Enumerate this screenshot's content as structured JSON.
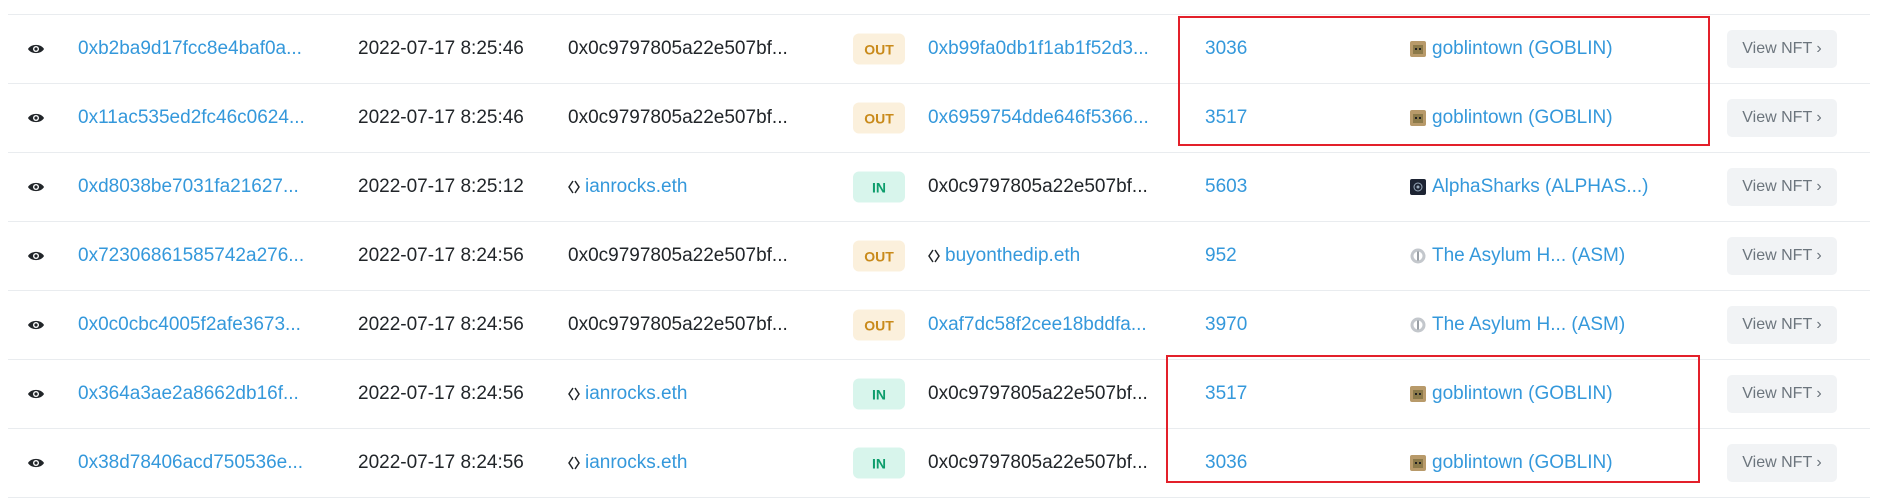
{
  "rows": [
    {
      "hash": "0xb2ba9d17fcc8e4baf0a...",
      "age": "2022-07-17 8:25:46",
      "from": "0x0c9797805a22e507bf...",
      "dir": "OUT",
      "to": "0xb99fa0db1f1ab1f52d3...",
      "token_id": "3036",
      "item": "goblintown (GOBLIN)",
      "button": "View NFT ›"
    },
    {
      "hash": "0x11ac535ed2fc46c0624...",
      "age": "2022-07-17 8:25:46",
      "from": "0x0c9797805a22e507bf...",
      "dir": "OUT",
      "to": "0x6959754dde646f5366...",
      "token_id": "3517",
      "item": "goblintown (GOBLIN)",
      "button": "View NFT ›"
    },
    {
      "hash": "0xd8038be7031fa21627...",
      "age": "2022-07-17 8:25:12",
      "from": "ianrocks.eth",
      "dir": "IN",
      "to": "0x0c9797805a22e507bf...",
      "token_id": "5603",
      "item": "AlphaSharks (ALPHAS...)",
      "button": "View NFT ›"
    },
    {
      "hash": "0x72306861585742a276...",
      "age": "2022-07-17 8:24:56",
      "from": "0x0c9797805a22e507bf...",
      "dir": "OUT",
      "to": "buyonthedip.eth",
      "token_id": "952",
      "item": "The Asylum H... (ASM)",
      "button": "View NFT ›"
    },
    {
      "hash": "0x0c0cbc4005f2afe3673...",
      "age": "2022-07-17 8:24:56",
      "from": "0x0c9797805a22e507bf...",
      "dir": "OUT",
      "to": "0xaf7dc58f2cee18bddfa...",
      "token_id": "3970",
      "item": "The Asylum H... (ASM)",
      "button": "View NFT ›"
    },
    {
      "hash": "0x364a3ae2a8662db16f...",
      "age": "2022-07-17 8:24:56",
      "from": "ianrocks.eth",
      "dir": "IN",
      "to": "0x0c9797805a22e507bf...",
      "token_id": "3517",
      "item": "goblintown (GOBLIN)",
      "button": "View NFT ›"
    },
    {
      "hash": "0x38d78406acd750536e...",
      "age": "2022-07-17 8:24:56",
      "from": "ianrocks.eth",
      "dir": "IN",
      "to": "0x0c9797805a22e507bf...",
      "token_id": "3036",
      "item": "goblintown (GOBLIN)",
      "button": "View NFT ›"
    }
  ],
  "icons": {
    "eye": "eye-icon",
    "ens": "ens-icon",
    "goblin": "goblintown-token-icon",
    "sharks": "alphasharks-token-icon",
    "asylum": "asylum-token-icon"
  },
  "colors": {
    "link": "#3498db",
    "out_bg": "#fbf0dc",
    "out_text": "#c98a1a",
    "in_bg": "#d8f5ec",
    "in_text": "#0d9d6c",
    "highlight": "#e3202a"
  }
}
